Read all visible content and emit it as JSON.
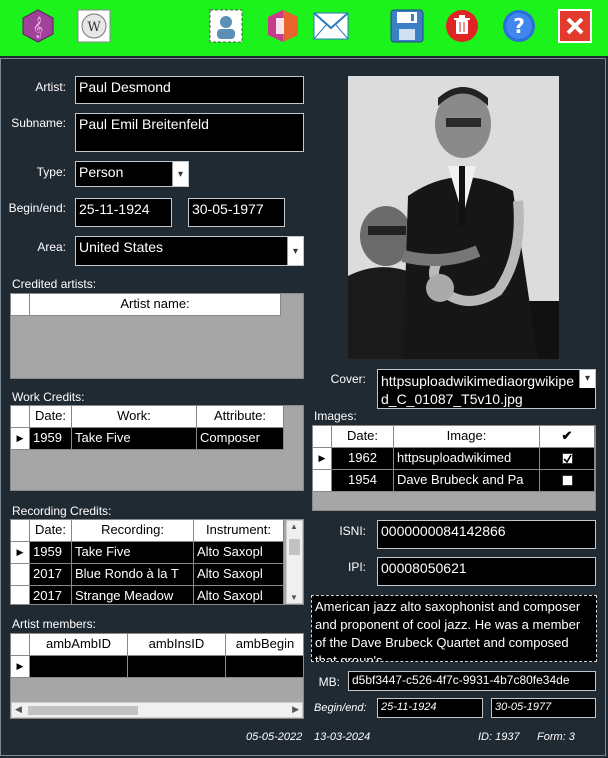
{
  "toolbar": {
    "icons": [
      "music-clef-icon",
      "wikipedia-icon",
      "portrait-icon",
      "office-icon",
      "mail-icon",
      "save-icon",
      "delete-icon",
      "help-icon",
      "close-icon"
    ]
  },
  "form": {
    "artist_label": "Artist:",
    "artist": "Paul Desmond",
    "subname_label": "Subname:",
    "subname": "Paul Emil Breitenfeld",
    "type_label": "Type:",
    "type": "Person",
    "beginend_label": "Begin/end:",
    "begin": "25-11-1924",
    "end": "30-05-1977",
    "area_label": "Area:",
    "area": "United States",
    "credited_label": "Credited artists:",
    "credited_header": "Artist name:",
    "work_label": "Work Credits:",
    "work_headers": [
      "Date:",
      "Work:",
      "Attribute:"
    ],
    "work_rows": [
      [
        "1959",
        "Take Five",
        "Composer"
      ]
    ],
    "rec_label": "Recording Credits:",
    "rec_headers": [
      "Date:",
      "Recording:",
      "Instrument:"
    ],
    "rec_rows": [
      [
        "1959",
        "Take Five",
        "Alto Saxopl"
      ],
      [
        "2017",
        "Blue Rondo à la T",
        "Alto Saxopl"
      ],
      [
        "2017",
        "Strange Meadow",
        "Alto Saxopl"
      ]
    ],
    "members_label": "Artist members:",
    "members_headers": [
      "ambAmbID",
      "ambInsID",
      "ambBegin"
    ],
    "cover_label": "Cover:",
    "cover": "httpsuploadwikimediaorgwikiped_C_01087_T5v10.jpg",
    "images_label": "Images:",
    "images_headers": [
      "Date:",
      "Image:",
      "✔"
    ],
    "images_rows": [
      {
        "date": "1962",
        "image": "httpsuploadwikimed",
        "checked": true
      },
      {
        "date": "1954",
        "image": "Dave Brubeck and Pa",
        "checked": false
      }
    ],
    "isni_label": "ISNI:",
    "isni": "0000000084142866",
    "ipi_label": "IPI:",
    "ipi": "00008050621",
    "description": "American jazz alto saxophonist and composer and proponent of cool jazz. He was a member of the Dave Brubeck Quartet and composed that group's",
    "mb_label": "MB:",
    "mb": "d5bf3447-c526-4f7c-9931-4b7c80fe34de",
    "beginend2_label": "Begin/end:",
    "begin2": "25-11-1924",
    "end2": "30-05-1977",
    "footer_date1": "05-05-2022",
    "footer_date2": "13-03-2024",
    "footer_id": "ID: 1937",
    "footer_form": "Form: 3"
  }
}
